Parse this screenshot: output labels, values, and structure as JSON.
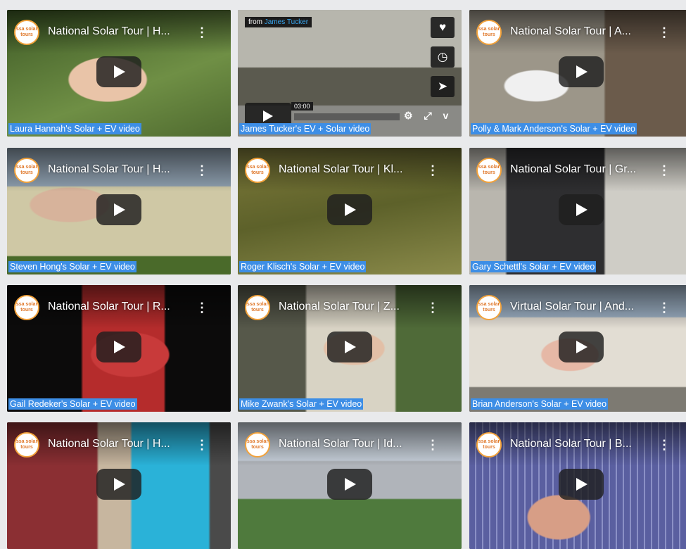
{
  "logo_text": "ssa solar tours",
  "tiles": [
    {
      "title": "National Solar Tour | H...",
      "caption": "Laura Hannah's Solar + EV video",
      "bg": "#5f7a3c"
    },
    {
      "title": "",
      "caption": "James Tucker's EV + Solar video",
      "bg": "#7c7a73",
      "vimeo": true
    },
    {
      "title": "National Solar Tour | A...",
      "caption": "Polly & Mark Anderson's Solar + EV video",
      "bg": "#8a8478"
    },
    {
      "title": "National Solar Tour | H...",
      "caption": "Steven Hong's Solar + EV video",
      "bg": "#6f7b66"
    },
    {
      "title": "National Solar Tour | Kl...",
      "caption": "Roger Klisch's Solar + EV video",
      "bg": "#6f6b34"
    },
    {
      "title": "National Solar Tour | Gr...",
      "caption": "Gary Schettl's Solar + EV video",
      "bg": "#9a9890"
    },
    {
      "title": "National Solar Tour | R...",
      "caption": "Gail Redeker's Solar + EV video",
      "bg": "#1a1414"
    },
    {
      "title": "National Solar Tour | Z...",
      "caption": "Mike Zwank's Solar + EV video",
      "bg": "#5b5a4a"
    },
    {
      "title": "Virtual Solar Tour | And...",
      "caption": "Brian Anderson's Solar + EV video",
      "bg": "#9aa0a6"
    },
    {
      "title": "National Solar Tour | H...",
      "caption": "",
      "bg": "#5a3a34"
    },
    {
      "title": "National Solar Tour | Id...",
      "caption": "",
      "bg": "#6f7583"
    },
    {
      "title": "National Solar Tour | B...",
      "caption": "",
      "bg": "#7c7fa0"
    }
  ],
  "vimeo": {
    "from_label": "from",
    "from_name": "James Tucker",
    "time": "03:00",
    "heart_icon": "♥",
    "clock_icon": "◷",
    "send_icon": "➤",
    "controls": "⚙ ⤢ v"
  }
}
